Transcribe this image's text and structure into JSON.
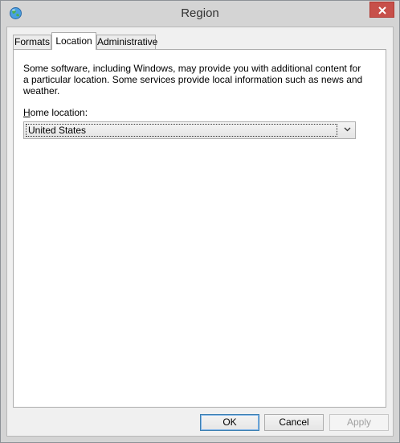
{
  "window": {
    "title": "Region"
  },
  "tabs": [
    {
      "label": "Formats",
      "active": false
    },
    {
      "label": "Location",
      "active": true
    },
    {
      "label": "Administrative",
      "active": false
    }
  ],
  "location": {
    "description": "Some software, including Windows, may provide you with additional content for a particular location. Some services provide local information such as news and weather.",
    "home_label_accel": "H",
    "home_label_rest": "ome location:",
    "home_value": "United States"
  },
  "buttons": {
    "ok": "OK",
    "cancel": "Cancel",
    "apply": "Apply"
  },
  "colors": {
    "close_button": "#c7504a",
    "accent_border": "#3c7fb1"
  },
  "icons": {
    "app": "globe-icon",
    "close": "close-icon",
    "dropdown": "chevron-down-icon"
  }
}
